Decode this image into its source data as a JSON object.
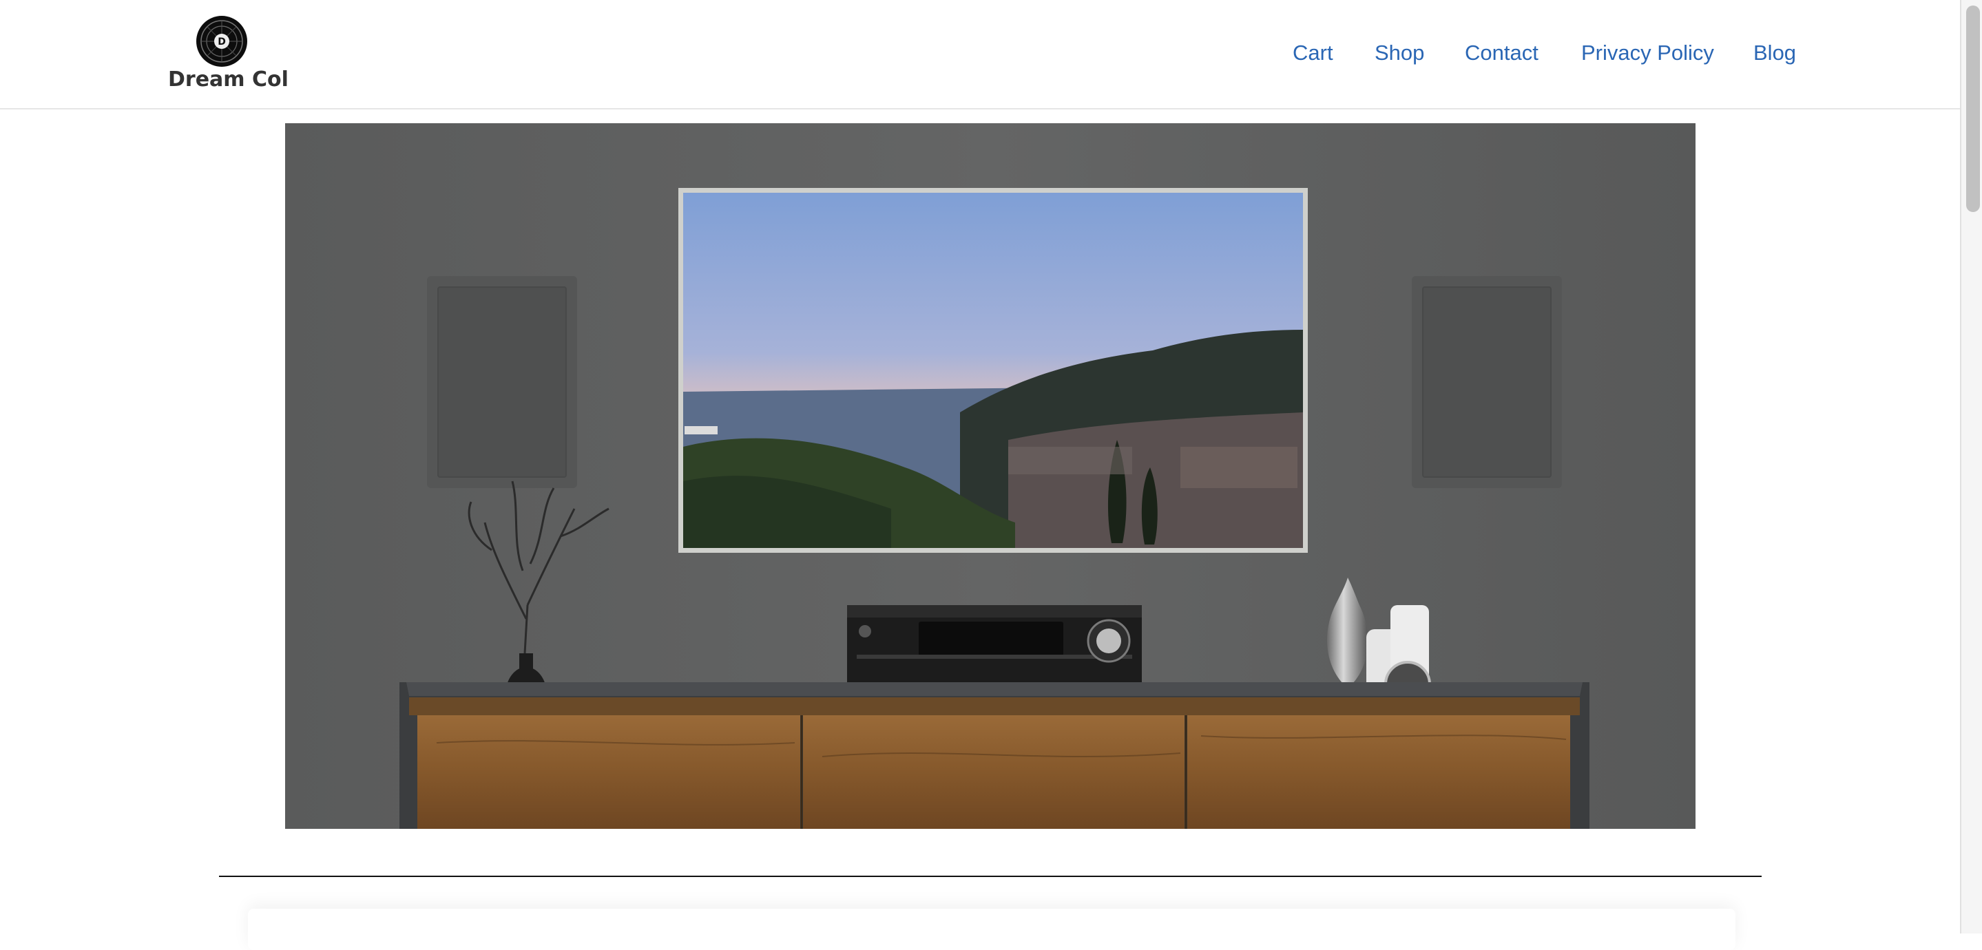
{
  "site": {
    "brand_name": "Dream Col",
    "logo_letter": "D"
  },
  "nav": {
    "items": [
      {
        "label": "Cart"
      },
      {
        "label": "Shop"
      },
      {
        "label": "Contact"
      },
      {
        "label": "Privacy Policy"
      },
      {
        "label": "Blog"
      }
    ]
  },
  "colors": {
    "link": "#2a66b4",
    "wall": "#5e5f5f",
    "wood": "#8a5a2c"
  },
  "hero": {
    "icon": "living-room-tv-image"
  }
}
